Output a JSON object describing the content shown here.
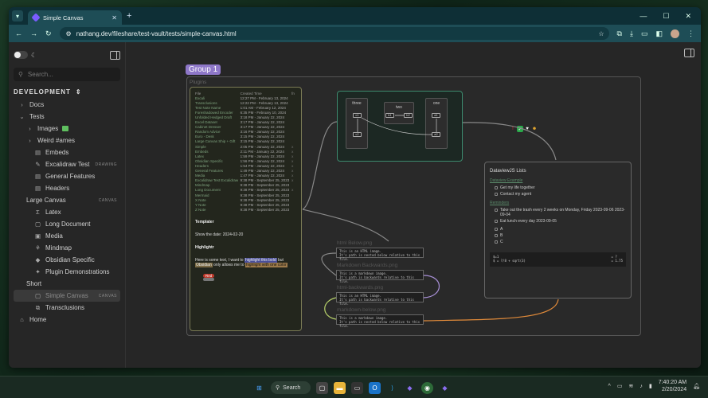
{
  "browser": {
    "tab_title": "Simple Canvas",
    "url": "nathang.dev/fileshare/test-vault/tests/simple-canvas.html"
  },
  "sidebar": {
    "search_placeholder": "Search...",
    "section": "DEVELOPMENT",
    "items": [
      {
        "label": "Docs",
        "tag": ""
      },
      {
        "label": "Tests",
        "tag": ""
      },
      {
        "label": "Images",
        "tag": ""
      },
      {
        "label": "Weird #ames",
        "tag": ""
      },
      {
        "label": "Embeds",
        "tag": ""
      },
      {
        "label": "Excalidraw Test",
        "tag": "DRAWING"
      },
      {
        "label": "General Features",
        "tag": ""
      },
      {
        "label": "Headers",
        "tag": ""
      },
      {
        "label": "Large Canvas",
        "tag": "CANVAS"
      },
      {
        "label": "Latex",
        "tag": ""
      },
      {
        "label": "Long Document",
        "tag": ""
      },
      {
        "label": "Media",
        "tag": ""
      },
      {
        "label": "Mindmap",
        "tag": ""
      },
      {
        "label": "Obsidian Specific",
        "tag": ""
      },
      {
        "label": "Plugin Demonstrations",
        "tag": ""
      },
      {
        "label": "Short",
        "tag": ""
      },
      {
        "label": "Simple Canvas",
        "tag": "CANVAS"
      },
      {
        "label": "Transclusions",
        "tag": ""
      },
      {
        "label": "Home",
        "tag": ""
      }
    ]
  },
  "canvas": {
    "group_label": "Group 1",
    "plugins_title": "Plugins",
    "plugins_table": {
      "headers": [
        "File",
        "Created Time",
        "fn"
      ],
      "rows": [
        [
          "Excali",
          "12:27 PM - February 13, 2024",
          ""
        ],
        [
          "Transclusions",
          "12:22 PM - February 13, 2024",
          ""
        ],
        [
          "Test Note Name",
          "1:01 AM - February 12, 2024",
          ""
        ],
        [
          "Foreshadowed Encoder",
          "6:35 PM - February 10, 2024",
          ""
        ],
        [
          "Unfolded Hedged Draft",
          "3:18 PM - January 22, 2024",
          ""
        ],
        [
          "Excel Dataset",
          "3:17 PM - January 22, 2024",
          ""
        ],
        [
          "Cabinet Dresser",
          "3:17 PM - January 22, 2024",
          ""
        ],
        [
          "Random Advice",
          "3:16 PM - January 22, 2024",
          ""
        ],
        [
          "Euro - Desk",
          "3:15 PM - January 22, 2024",
          ""
        ],
        [
          "Large Canvas Ship + Gift",
          "3:15 PM - January 22, 2024",
          ""
        ],
        [
          "Simple",
          "2:05 PM - January 22, 2024",
          "x"
        ],
        [
          "Embeds",
          "2:11 PM - January 22, 2024",
          "x"
        ],
        [
          "Latex",
          "1:59 PM - January 22, 2024",
          "x"
        ],
        [
          "Obsidian Specific",
          "1:56 PM - January 22, 2024",
          "x"
        ],
        [
          "Headers",
          "1:54 PM - January 22, 2024",
          "x"
        ],
        [
          "General Features",
          "1:49 PM - January 22, 2024",
          "x"
        ],
        [
          "Media",
          "1:47 PM - January 22, 2024",
          "x"
        ],
        [
          "Excalidraw Test Excalidraw",
          "9:38 PM - September 25, 2023",
          "x"
        ],
        [
          "Mindmap",
          "9:38 PM - September 25, 2023",
          ""
        ],
        [
          "Long Document",
          "9:38 PM - September 25, 2023",
          "x"
        ],
        [
          "Mermaid",
          "9:38 PM - September 25, 2023",
          ""
        ],
        [
          "X Note",
          "9:38 PM - September 25, 2023",
          ""
        ],
        [
          "Y Note",
          "9:38 PM - September 25, 2023",
          ""
        ],
        [
          "Z Note",
          "9:38 PM - September 25, 2023",
          ""
        ]
      ]
    },
    "templater_title": "Templater",
    "templater_date": "Show the date: 2024-02-20",
    "highlightr_title": "Highlightr",
    "hl_text_1": "Here is some text, I want to ",
    "hl_mark_1": "highlight this bold",
    "hl_text_2": " but ",
    "hl_mark_2": "Obsidian",
    "hl_text_3": " only allows me to ",
    "hl_mark_3": "highlight with one color",
    "bubble": "Red",
    "diagram": {
      "three": "three",
      "two": "two",
      "one": "one",
      "c1": "c1",
      "c2": "c2",
      "b1": "b1",
      "b2": "b2",
      "a1": "a1",
      "a2": "a2"
    },
    "emojis": [
      "!",
      "✓",
      "♥",
      "☻"
    ],
    "dataview": {
      "title": "DataviewJS Lists",
      "link1": "Dataview Example",
      "items1": [
        "Get my life together",
        "Contact my agent"
      ],
      "link2": "Reminders",
      "task1": "Take out the trash every 2 weeks on Monday, Friday 2023-09-06 2023-09-04",
      "task2": "Eat lunch every day 2023-09-05",
      "abc": [
        "A",
        "B",
        "C"
      ],
      "code_left_1": "$=1",
      "code_left_2": "$ = ?/8 + sqrt(3)",
      "code_right_1": "= ?",
      "code_right_2": "= 1.75"
    },
    "notes": [
      {
        "title": "html Below.png",
        "lines": [
          "This is an HTML image.",
          "It's path is nested below relative to this file."
        ]
      },
      {
        "title": "Markdown Backwards.png",
        "lines": [
          "This is a markdown image.",
          "It's path is backwards relative to this file."
        ]
      },
      {
        "title": "html-backwards.png",
        "lines": [
          "This is an HTML image.",
          "It's path is backwards relative to this file."
        ]
      },
      {
        "title": "markdown-below.png",
        "lines": [
          "This is a markdown image.",
          "It's path is nested below relative to this file."
        ]
      }
    ]
  },
  "taskbar": {
    "search": "Search",
    "time": "7:40:20 AM",
    "date": "2/20/2024"
  }
}
